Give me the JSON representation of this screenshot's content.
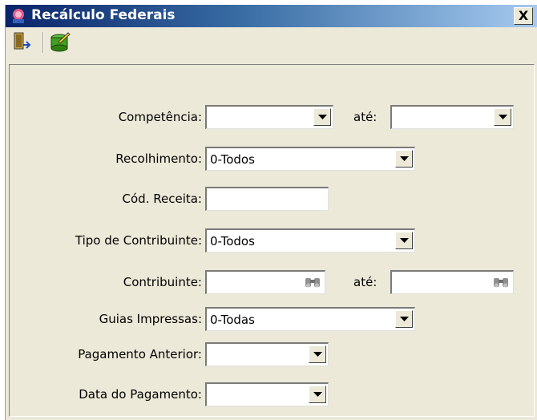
{
  "window": {
    "title": "Recálculo Federais",
    "close_label": "X"
  },
  "toolbar": {
    "exit_icon": "exit-door-icon",
    "recalc_icon": "recalculate-icon"
  },
  "form": {
    "competencia": {
      "label": "Competência:",
      "value": "",
      "ate_label": "até:",
      "ate_value": ""
    },
    "recolhimento": {
      "label": "Recolhimento:",
      "value": "0-Todos"
    },
    "cod_receita": {
      "label": "Cód. Receita:",
      "value": ""
    },
    "tipo_contribuinte": {
      "label": "Tipo de Contribuinte:",
      "value": "0-Todos"
    },
    "contribuinte": {
      "label": "Contribuinte:",
      "value": "",
      "ate_label": "até:",
      "ate_value": ""
    },
    "guias_impressas": {
      "label": "Guias Impressas:",
      "value": "0-Todas"
    },
    "pagamento_anterior": {
      "label": "Pagamento Anterior:",
      "value": ""
    },
    "data_pagamento": {
      "label": "Data do Pagamento:",
      "value": ""
    }
  },
  "colors": {
    "titlebar_start": "#0a246a",
    "titlebar_end": "#a6caf0",
    "window_bg": "#ece9d8"
  }
}
